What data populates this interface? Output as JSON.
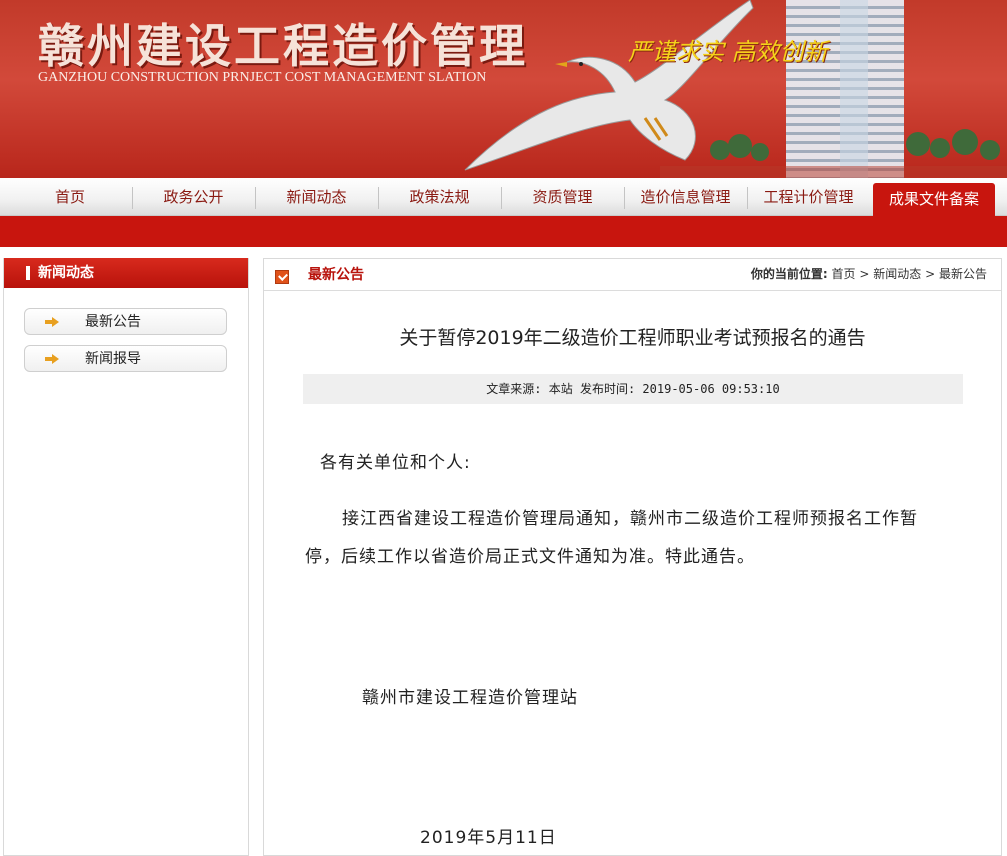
{
  "header": {
    "title_cn": "赣州建设工程造价管理",
    "title_en": "GANZHOU CONSTRUCTION PRNJECT COST MANAGEMENT SLATION",
    "slogan": "严谨求实   高效创新"
  },
  "nav": {
    "items": [
      "首页",
      "政务公开",
      "新闻动态",
      "政策法规",
      "资质管理",
      "造价信息管理",
      "工程计价管理"
    ],
    "active": "成果文件备案"
  },
  "sidebar": {
    "title": "新闻动态",
    "items": [
      "最新公告",
      "新闻报导"
    ]
  },
  "main": {
    "section_title": "最新公告",
    "breadcrumb_label": "你的当前位置:",
    "breadcrumb": [
      "首页",
      "新闻动态",
      "最新公告"
    ],
    "article": {
      "title": "关于暂停2019年二级造价工程师职业考试预报名的通告",
      "meta": "文章来源: 本站   发布时间: 2019-05-06 09:53:10",
      "greeting": "各有关单位和个人:",
      "body_line1": "接江西省建设工程造价管理局通知，赣州市二级造价工程师预报名工作暂",
      "body_line2": "停，后续工作以省造价局正式文件通知为准。特此通告。",
      "signature": "赣州市建设工程造价管理站",
      "date": "2019年5月11日"
    }
  },
  "colors": {
    "brand_red": "#c8150e",
    "banner_red": "#c23a2a",
    "slogan_yellow": "#f5d21a",
    "nav_text": "#8a1a12"
  }
}
